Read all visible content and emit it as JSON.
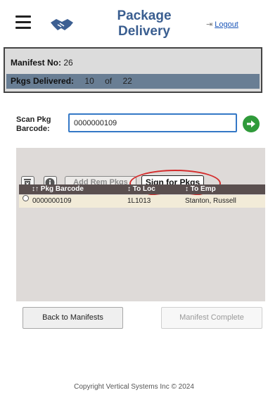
{
  "header": {
    "title_line1": "Package",
    "title_line2": "Delivery",
    "logout_label": "Logout"
  },
  "manifest": {
    "no_label": "Manifest No:",
    "no_value": "26",
    "delivered_label": "Pkgs Delivered:",
    "delivered_count": "10",
    "of_label": "of",
    "total": "22"
  },
  "scan": {
    "label_line1": "Scan Pkg",
    "label_line2": "Barcode:",
    "value": "0000000109"
  },
  "toolbar": {
    "add_rem_label": "Add Rem Pkgs",
    "sign_label": "Sign for Pkgs"
  },
  "table": {
    "headers": [
      "Pkg Barcode",
      "To Loc",
      "To Emp"
    ],
    "rows": [
      {
        "barcode": "0000000109",
        "to_loc": "1L1013",
        "to_emp": "Stanton, Russell"
      }
    ]
  },
  "footer_buttons": {
    "back_label": "Back to Manifests",
    "complete_label": "Manifest Complete"
  },
  "copyright": "Copyright Vertical Systems Inc © 2024",
  "colors": {
    "title": "#3a5e90",
    "progress_band": "#697e94",
    "accent_input_border": "#3478c6",
    "go_button": "#2f9a3a",
    "highlight_circle": "#d42c2c",
    "table_header": "#5a4f4f",
    "row_bg": "#f2ebd8"
  },
  "icons": [
    "hamburger-menu-icon",
    "handshake-icon",
    "logout-icon",
    "arrow-right-circle-icon",
    "trash-icon",
    "info-icon",
    "sort-icon",
    "radio-icon"
  ]
}
